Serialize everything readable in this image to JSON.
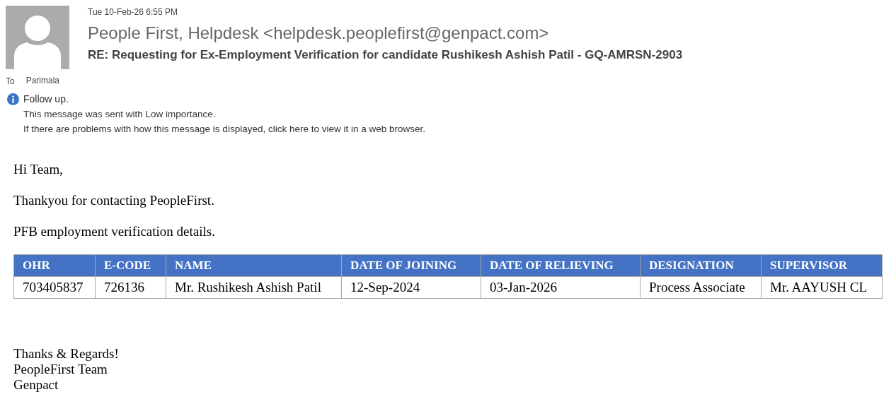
{
  "header": {
    "time": "Tue 10-Feb-26 6:55 PM",
    "sender": "People First, Helpdesk <helpdesk.peoplefirst@genpact.com>",
    "subject": "RE: Requesting for Ex-Employment Verification for candidate Rushikesh Ashish Patil - GQ-AMRSN-2903",
    "to_label": "To",
    "to": "Parimala"
  },
  "info": {
    "lines": [
      "Follow up.",
      "This message was sent with Low importance.",
      "If there are problems with how this message is displayed, click here to view it in a web browser."
    ]
  },
  "body": {
    "greeting": "Hi Team,",
    "paragraphs": [
      "Thankyou for contacting PeopleFirst.",
      "PFB employment verification details."
    ],
    "table": {
      "columns": [
        "OHR",
        "E-CODE",
        "NAME",
        "DATE OF JOINING",
        "DATE OF RELIEVING",
        "DESIGNATION",
        "SUPERVISOR"
      ],
      "rows": [
        [
          "703405837",
          "726136",
          "Mr. Rushikesh Ashish Patil",
          "12-Sep-2024",
          "03-Jan-2026",
          "Process Associate",
          "Mr. AAYUSH CL"
        ]
      ]
    },
    "signature": [
      "Thanks & Regards!",
      "PeopleFirst Team",
      "Genpact"
    ]
  }
}
